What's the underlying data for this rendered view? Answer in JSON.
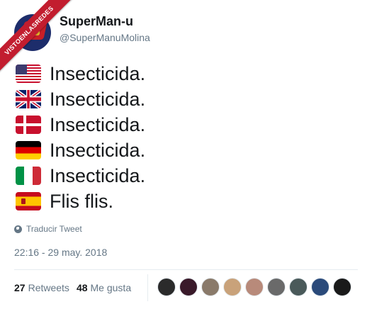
{
  "watermark": "VISTOENLASREDES",
  "user": {
    "display_name": "SuperMan-u",
    "handle": "@SuperManuMolina"
  },
  "tweet_lines": [
    {
      "flag": "flag-us-icon",
      "text": "Insecticida."
    },
    {
      "flag": "flag-gb-icon",
      "text": "Insecticida."
    },
    {
      "flag": "flag-dk-icon",
      "text": "Insecticida."
    },
    {
      "flag": "flag-de-icon",
      "text": "Insecticida."
    },
    {
      "flag": "flag-it-icon",
      "text": "Insecticida."
    },
    {
      "flag": "flag-es-icon",
      "text": "Flis flis."
    }
  ],
  "translate_label": "Traducir Tweet",
  "timestamp": "22:16 - 29 may. 2018",
  "stats": {
    "retweets_count": "27",
    "retweets_label": "Retweets",
    "likes_count": "48",
    "likes_label": "Me gusta"
  },
  "liker_colors": [
    "#2b2b2b",
    "#3a1a2a",
    "#8a7a6a",
    "#c9a27a",
    "#b88a7a",
    "#6a6a6a",
    "#4a5a5a",
    "#2a4a7a",
    "#1a1a1a"
  ],
  "colors": {
    "text": "#14171a",
    "secondary": "#657786",
    "watermark": "#c21d2f"
  }
}
